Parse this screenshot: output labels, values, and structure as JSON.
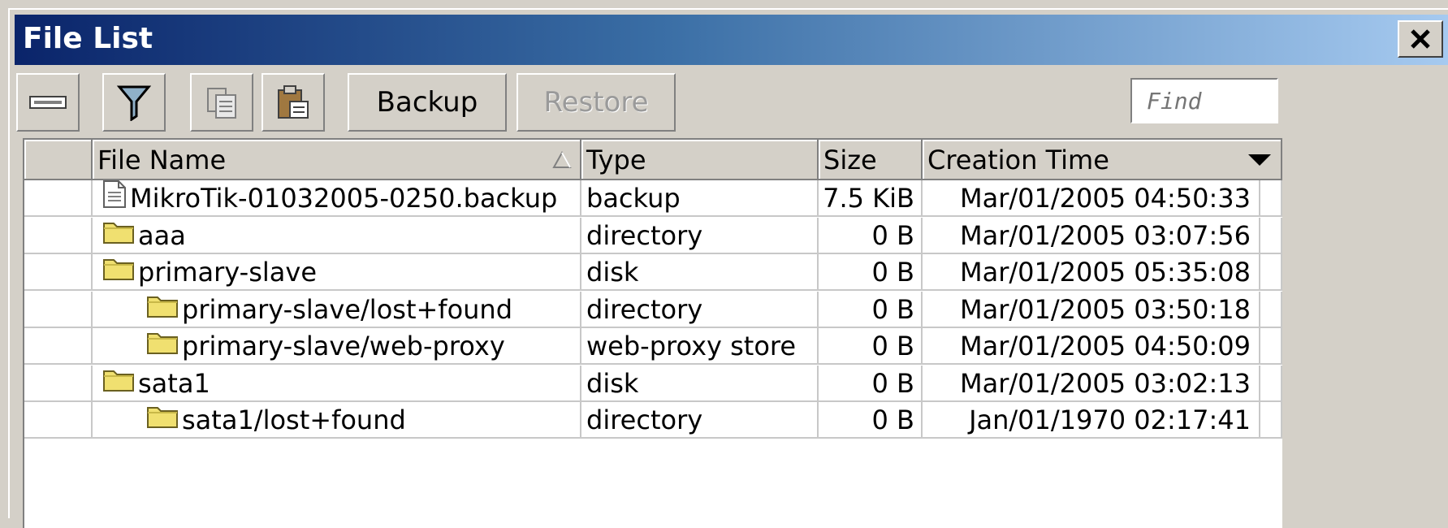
{
  "window": {
    "title": "File List"
  },
  "toolbar": {
    "backup_label": "Backup",
    "restore_label": "Restore",
    "find_placeholder": "Find"
  },
  "columns": [
    "File Name",
    "Type",
    "Size",
    "Creation Time"
  ],
  "files": [
    {
      "name": "MikroTik-01032005-0250.backup",
      "type": "backup",
      "size": "7.5 KiB",
      "time": "Mar/01/2005 04:50:33",
      "icon": "file-icon",
      "indent": 0
    },
    {
      "name": "aaa",
      "type": "directory",
      "size": "0 B",
      "time": "Mar/01/2005 03:07:56",
      "icon": "folder-icon",
      "indent": 0
    },
    {
      "name": "primary-slave",
      "type": "disk",
      "size": "0 B",
      "time": "Mar/01/2005 05:35:08",
      "icon": "folder-icon",
      "indent": 0
    },
    {
      "name": "primary-slave/lost+found",
      "type": "directory",
      "size": "0 B",
      "time": "Mar/01/2005 03:50:18",
      "icon": "folder-icon",
      "indent": 1
    },
    {
      "name": "primary-slave/web-proxy",
      "type": "web-proxy store",
      "size": "0 B",
      "time": "Mar/01/2005 04:50:09",
      "icon": "folder-icon",
      "indent": 1
    },
    {
      "name": "sata1",
      "type": "disk",
      "size": "0 B",
      "time": "Mar/01/2005 03:02:13",
      "icon": "folder-icon",
      "indent": 0
    },
    {
      "name": "sata1/lost+found",
      "type": "directory",
      "size": "0 B",
      "time": "Jan/01/1970 02:17:41",
      "icon": "folder-icon",
      "indent": 1
    }
  ]
}
